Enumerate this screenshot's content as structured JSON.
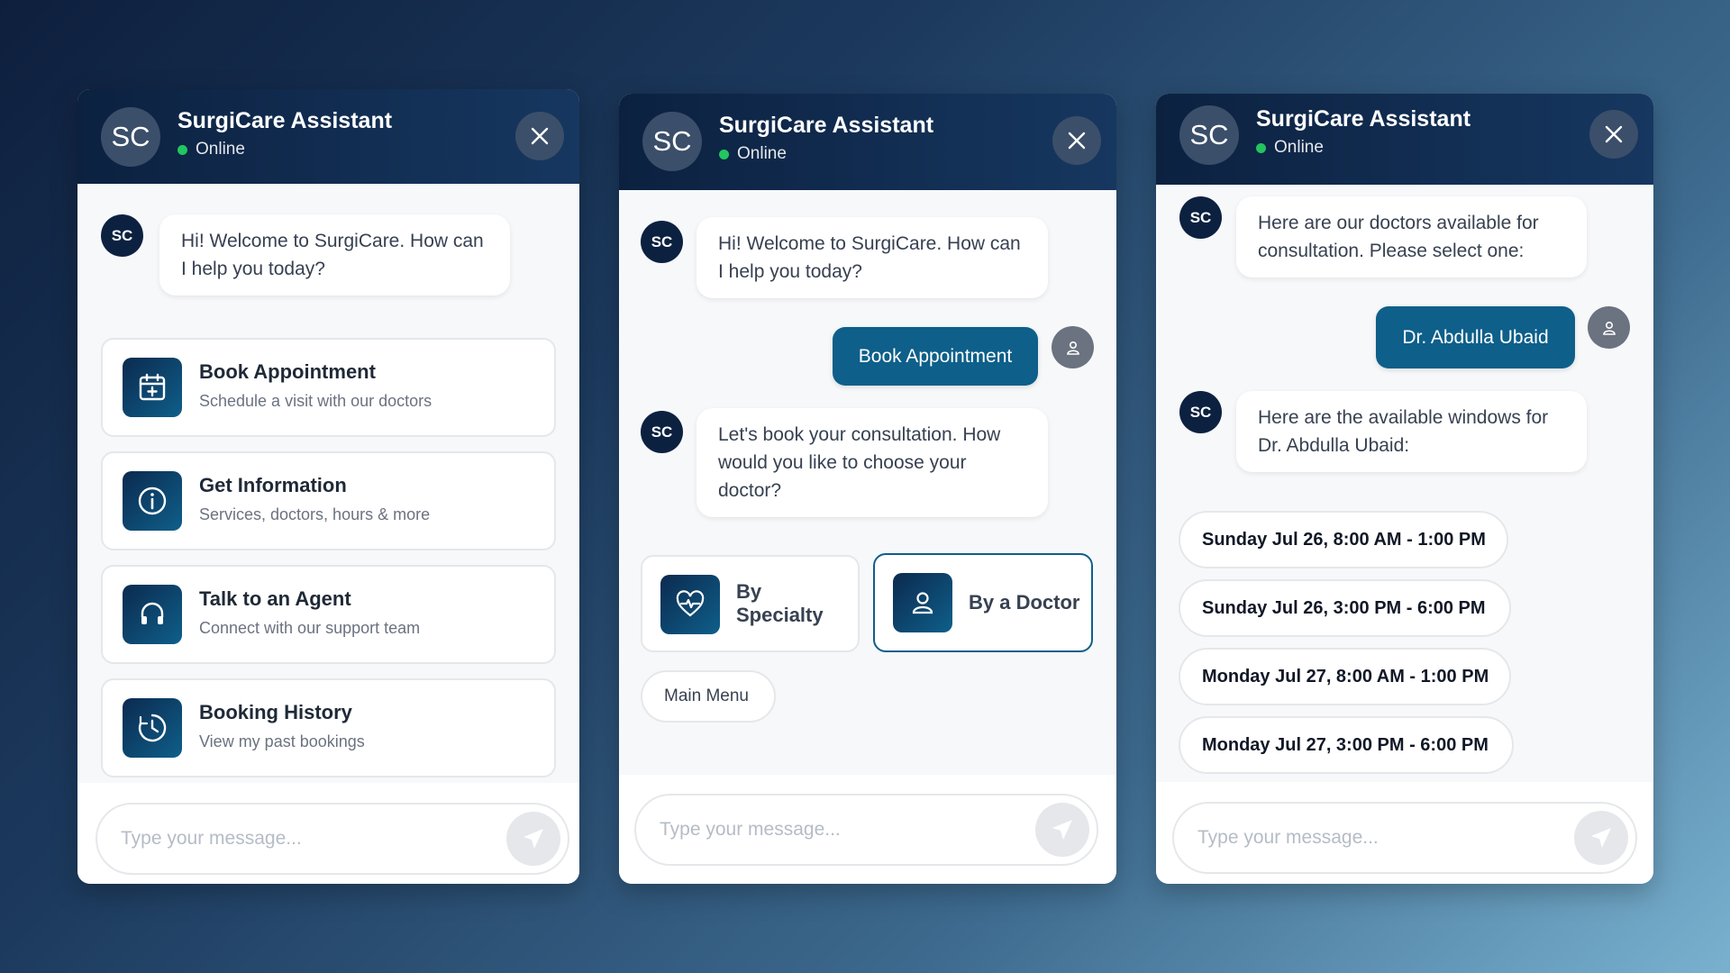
{
  "assistant": {
    "avatar_initials": "SC",
    "name": "SurgiCare Assistant",
    "status": "Online",
    "bot_avatar_initials": "SC"
  },
  "input": {
    "placeholder": "Type your message..."
  },
  "panel1": {
    "welcome": "Hi! Welcome to SurgiCare. How can I help you today?",
    "menu": [
      {
        "title": "Book Appointment",
        "subtitle": "Schedule a visit with our doctors",
        "icon": "calendar-plus-icon"
      },
      {
        "title": "Get Information",
        "subtitle": "Services, doctors, hours & more",
        "icon": "info-icon"
      },
      {
        "title": "Talk to an Agent",
        "subtitle": "Connect with our support team",
        "icon": "headset-icon"
      },
      {
        "title": "Booking History",
        "subtitle": "View my past bookings",
        "icon": "clock-history-icon"
      }
    ]
  },
  "panel2": {
    "welcome": "Hi! Welcome to SurgiCare. How can I help you today?",
    "user_message": "Book Appointment",
    "bot_message": "Let's book your consultation. How would you like to choose your doctor?",
    "choices": [
      {
        "label_line1": "By",
        "label_line2": "Specialty",
        "icon": "heart-pulse-icon"
      },
      {
        "label": "By a Doctor",
        "icon": "user-icon",
        "selected": true
      }
    ],
    "main_menu": "Main Menu"
  },
  "panel3": {
    "bot_message_1": "Here are our doctors available for consultation. Please select one:",
    "user_message": "Dr. Abdulla Ubaid",
    "bot_message_2": "Here are the available windows for Dr. Abdulla Ubaid:",
    "slots": [
      "Sunday Jul 26, 8:00 AM - 1:00 PM",
      "Sunday Jul 26, 3:00 PM - 6:00 PM",
      "Monday Jul 27, 8:00 AM - 1:00 PM",
      "Monday Jul 27, 3:00 PM - 6:00 PM"
    ]
  },
  "colors": {
    "header": "#0c2140",
    "accent": "#0e5f8a",
    "online": "#22c55e",
    "background_start": "#0e1f3d",
    "background_end": "#79b1cf"
  }
}
